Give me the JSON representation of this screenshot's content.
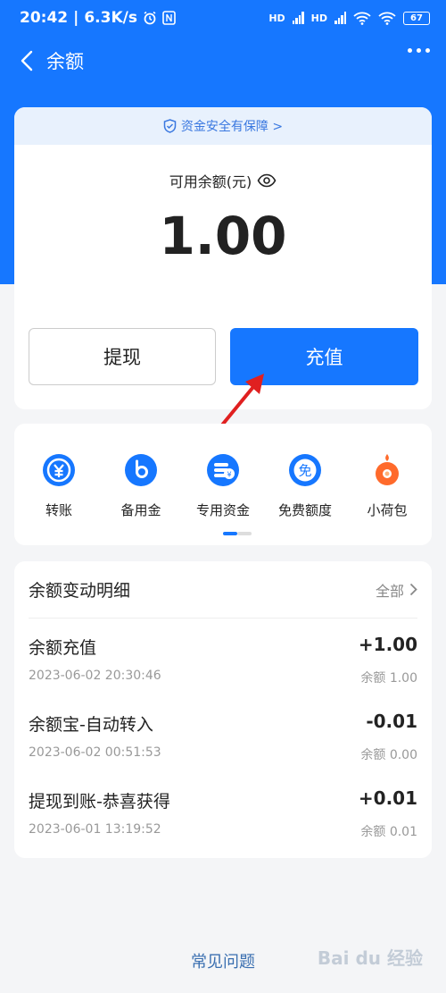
{
  "status_bar": {
    "time": "20:42",
    "speed": "6.3K/s",
    "hd1": "HD",
    "hd2": "HD",
    "battery": "67"
  },
  "nav": {
    "title": "余额"
  },
  "balance": {
    "safe_text": "资金安全有保障 >",
    "label": "可用余额(元)",
    "amount": "1.00",
    "withdraw_label": "提现",
    "recharge_label": "充值"
  },
  "shortcuts": [
    {
      "label": "转账",
      "icon": "transfer-icon",
      "color": "#1677ff"
    },
    {
      "label": "备用金",
      "icon": "reserve-fund-icon",
      "color": "#1677ff"
    },
    {
      "label": "专用资金",
      "icon": "dedicated-fund-icon",
      "color": "#1677ff"
    },
    {
      "label": "免费额度",
      "icon": "free-quota-icon",
      "color": "#1677ff"
    },
    {
      "label": "小荷包",
      "icon": "small-purse-icon",
      "color": "#ff6a2b"
    }
  ],
  "details": {
    "title": "余额变动明细",
    "all_link": "全部",
    "items": [
      {
        "name": "余额充值",
        "time": "2023-06-02 20:30:46",
        "amount": "+1.00",
        "balance": "余额 1.00"
      },
      {
        "name": "余额宝-自动转入",
        "time": "2023-06-02 00:51:53",
        "amount": "-0.01",
        "balance": "余额 0.00"
      },
      {
        "name": "提现到账-恭喜获得",
        "time": "2023-06-01 13:19:52",
        "amount": "+0.01",
        "balance": "余额 0.01"
      }
    ]
  },
  "faq": "常见问题",
  "watermark": "Bai du 经验"
}
